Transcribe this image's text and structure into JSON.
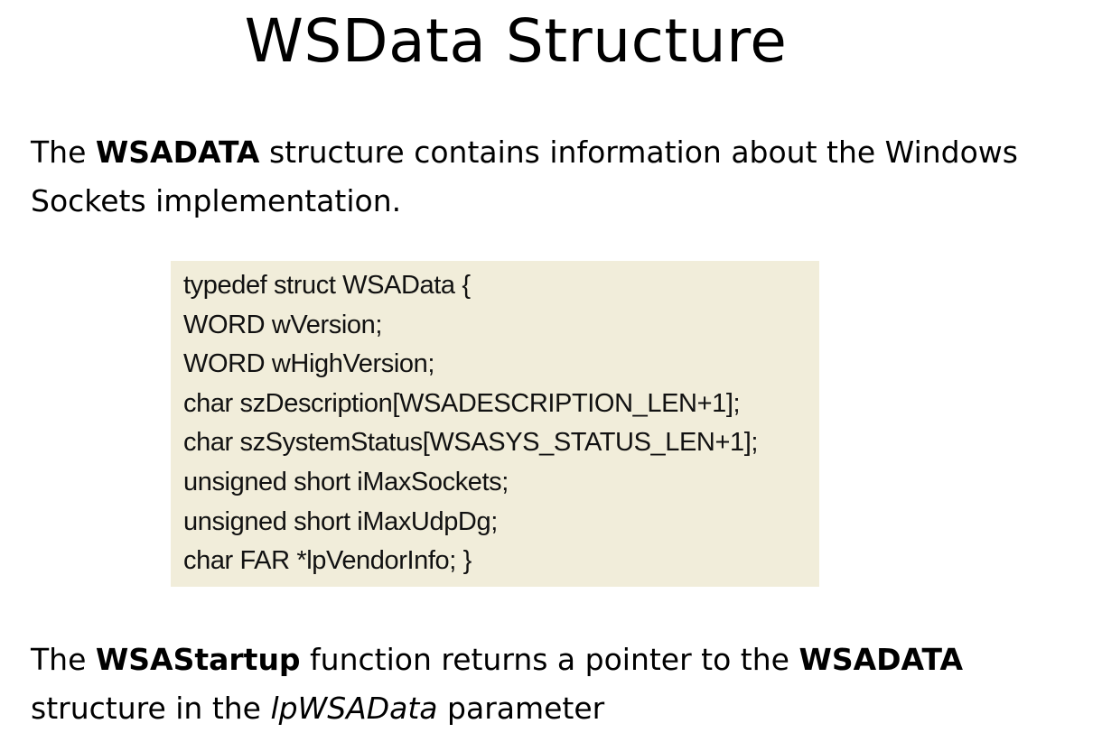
{
  "title": "WSData Structure",
  "intro": {
    "prefix": "The ",
    "bold": "WSADATA",
    "rest_line1": " structure contains information about the Windows",
    "line2": "Sockets implementation."
  },
  "code": {
    "lines": [
      "typedef struct WSAData {",
      "WORD wVersion;",
      "WORD wHighVersion;",
      "char szDescription[WSADESCRIPTION_LEN+1];",
      "char szSystemStatus[WSASYS_STATUS_LEN+1];",
      "unsigned short iMaxSockets;",
      "unsigned short iMaxUdpDg;",
      "char FAR *lpVendorInfo; }"
    ]
  },
  "outro": {
    "prefix": "The ",
    "bold1": "WSAStartup",
    "middle": " function returns a pointer to the ",
    "bold2": "WSADATA",
    "line2_prefix": "structure in the ",
    "italic": "lpWSAData",
    "line2_suffix": " parameter"
  },
  "colors": {
    "code_background": "#f1edda",
    "text": "#000000",
    "background": "#ffffff"
  }
}
